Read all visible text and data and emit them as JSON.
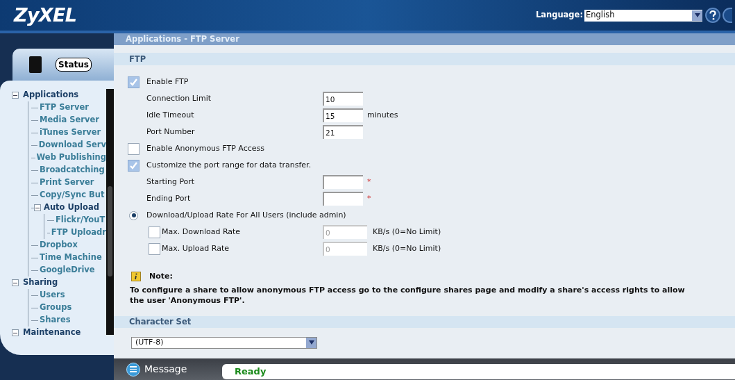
{
  "header": {
    "logo": "ZyXEL",
    "language_label": "Language:",
    "language": "English"
  },
  "sidebar": {
    "tab": "Status",
    "tree": [
      {
        "label": "Applications",
        "expanded": true,
        "children": [
          {
            "label": "FTP Server"
          },
          {
            "label": "Media Server"
          },
          {
            "label": "iTunes Server"
          },
          {
            "label": "Download Serv"
          },
          {
            "label": "Web Publishing"
          },
          {
            "label": "Broadcatching"
          },
          {
            "label": "Print Server"
          },
          {
            "label": "Copy/Sync But"
          },
          {
            "label": "Auto Upload",
            "expanded": true,
            "children": [
              {
                "label": "Flickr/YouT"
              },
              {
                "label": "FTP Uploadr"
              }
            ]
          },
          {
            "label": "Dropbox"
          },
          {
            "label": "Time Machine"
          },
          {
            "label": "GoogleDrive"
          }
        ]
      },
      {
        "label": "Sharing",
        "expanded": true,
        "children": [
          {
            "label": "Users"
          },
          {
            "label": "Groups"
          },
          {
            "label": "Shares"
          }
        ]
      },
      {
        "label": "Maintenance",
        "expanded": true
      }
    ]
  },
  "page_title": "Applications - FTP Server",
  "ftp": {
    "heading": "FTP",
    "rows": [
      {
        "kind": "checkbox",
        "label": "Enable FTP",
        "checked": true
      },
      {
        "kind": "input",
        "label": "Connection Limit",
        "value": "10"
      },
      {
        "kind": "input",
        "label": "Idle Timeout",
        "value": "15",
        "suffix": "minutes"
      },
      {
        "kind": "input",
        "label": "Port Number",
        "value": "21"
      },
      {
        "kind": "checkbox",
        "label": "Enable Anonymous FTP Access",
        "checked": false
      },
      {
        "kind": "checkbox",
        "label": "Customize the port range for data transfer.",
        "checked": true
      },
      {
        "kind": "input",
        "label": "Starting Port",
        "required": "*"
      },
      {
        "kind": "input",
        "label": "Ending Port",
        "required": "*"
      },
      {
        "kind": "radio",
        "label": "Download/Upload Rate For All Users (include admin)",
        "selected": true
      },
      {
        "kind": "rate",
        "label": "Max. Download Rate",
        "checked": false,
        "value": "0",
        "disabled": true,
        "suffix": "KB/s (0=No Limit)"
      },
      {
        "kind": "rate",
        "label": "Max. Upload Rate",
        "checked": false,
        "value": "0",
        "disabled": true,
        "suffix": "KB/s (0=No Limit)"
      }
    ],
    "note_title": "Note:",
    "note": "To configure a share to allow anonymous FTP access go to the configure shares page and modify a share's access rights to allow the user 'Anonymous FTP'."
  },
  "charset": {
    "heading": "Character Set",
    "value": "(UTF-8)"
  },
  "message_bar": {
    "label": "Message",
    "status": "Ready"
  }
}
